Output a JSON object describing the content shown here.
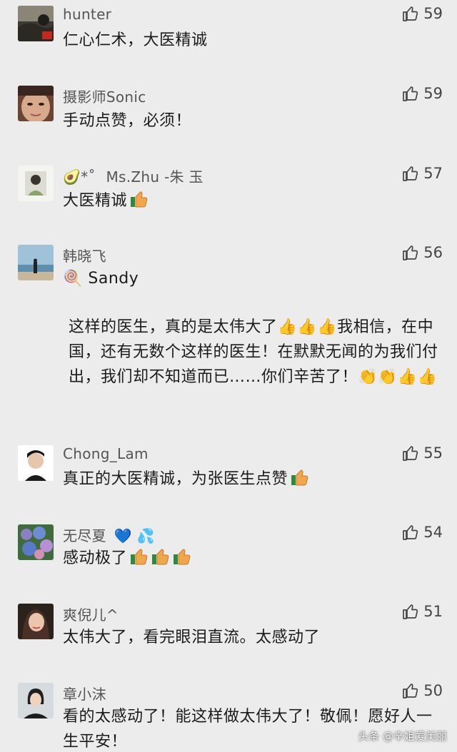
{
  "comments": [
    {
      "name": "hunter",
      "likes": "59",
      "text": "仁心仁术，大医精诚"
    },
    {
      "name": "摄影师Sonic",
      "likes": "59",
      "text": "手动点赞，必须！"
    },
    {
      "name": "Ms.Zhu -朱 玉",
      "name_prefix": "🥑*˚",
      "likes": "57",
      "text": "大医精诚"
    },
    {
      "name": "韩晓飞",
      "likes": "56",
      "text_line1": "🍭 Sandy",
      "text_para": "这样的医生，真的是太伟大了👍👍👍我相信，在中国，还有无数个这样的医生！在默默无闻的为我们付出，我们却不知道而已……你们辛苦了！👏👏👍👍"
    },
    {
      "name": "Chong_Lam",
      "likes": "55",
      "text": "真正的大医精诚，为张医生点赞"
    },
    {
      "name": "无尽夏",
      "name_suffix": "💙 💦",
      "likes": "54",
      "text": "感动极了"
    },
    {
      "name": "爽倪儿^",
      "likes": "51",
      "text": "太伟大了，看完眼泪直流。太感动了"
    },
    {
      "name": "章小沫",
      "likes": "50",
      "text": "看的太感动了！能这样做太伟大了！敬佩！愿好人一生平安！"
    }
  ],
  "watermark": "头条 @辛姐爱美丽",
  "icons": {
    "like": "thumbs-up-outline-icon",
    "emoji": "thumbs-up-emoji-icon"
  },
  "colors": {
    "background": "#ececec",
    "text": "#1b1b1b",
    "meta": "#555555",
    "emoji": "#f0a64a"
  }
}
